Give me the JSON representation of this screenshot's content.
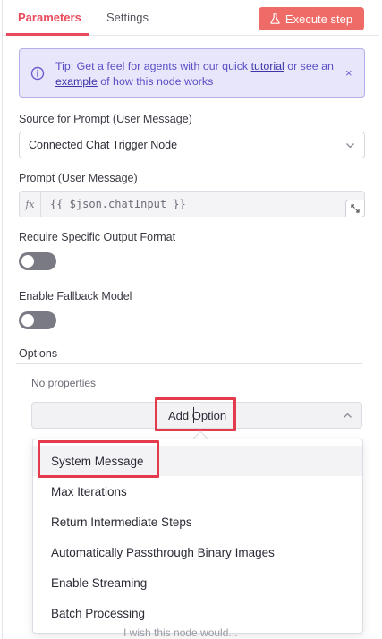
{
  "tabs": {
    "parameters": "Parameters",
    "settings": "Settings"
  },
  "execute_button": "Execute step",
  "tip": {
    "prefix": "Tip: Get a feel for agents with our quick ",
    "link1": "tutorial",
    "middle": " or see an ",
    "link2": "example",
    "suffix": " of how this node works",
    "close": "×"
  },
  "source": {
    "label": "Source for Prompt (User Message)",
    "value": "Connected Chat Trigger Node"
  },
  "prompt": {
    "label": "Prompt (User Message)",
    "fx": "fx",
    "value": "{{ $json.chatInput }}"
  },
  "require_output": {
    "label": "Require Specific Output Format",
    "enabled": false
  },
  "fallback": {
    "label": "Enable Fallback Model",
    "enabled": false
  },
  "options": {
    "label": "Options",
    "no_properties": "No properties",
    "add_option": "Add Option",
    "items": [
      "System Message",
      "Max Iterations",
      "Return Intermediate Steps",
      "Automatically Passthrough Binary Images",
      "Enable Streaming",
      "Batch Processing"
    ]
  },
  "feedback": "I wish this node would...",
  "colors": {
    "accent": "#ea4b5c",
    "execute_bg": "#ef6b67",
    "highlight": "#e33a4c",
    "tip_bg": "#e8e6fa",
    "tip_text": "#5a4fc4",
    "toggle_off": "#7a7a84"
  }
}
